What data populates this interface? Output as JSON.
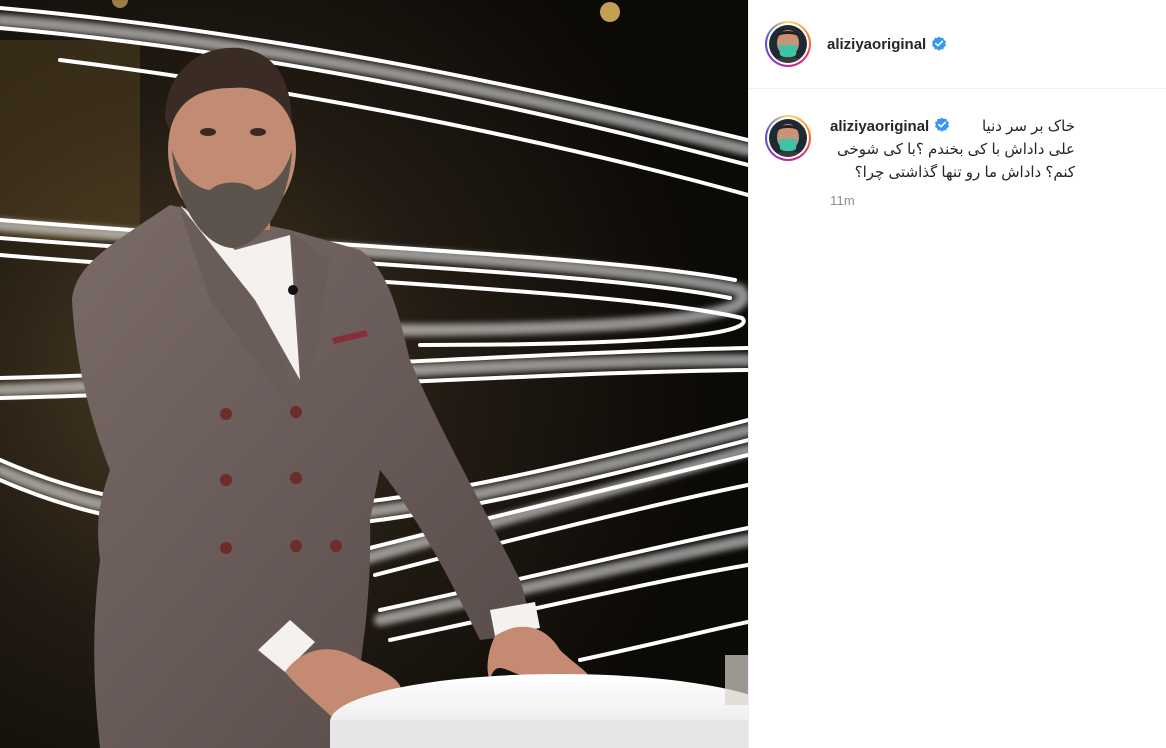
{
  "post": {
    "username": "aliziyaoriginal",
    "verified": true,
    "caption_lines": [
      "خاک بر سر دنیا",
      "علی داداش با کی بخندم ؟با کی شوخی",
      "کنم؟ داداش ما رو تنها گذاشتی چرا؟"
    ],
    "time_ago": "11m"
  },
  "icons": {
    "verified": "verified-badge-icon"
  },
  "colors": {
    "verified": "#3897f0",
    "text": "#262626",
    "muted": "#8e8e8e",
    "divider": "#efefef"
  }
}
